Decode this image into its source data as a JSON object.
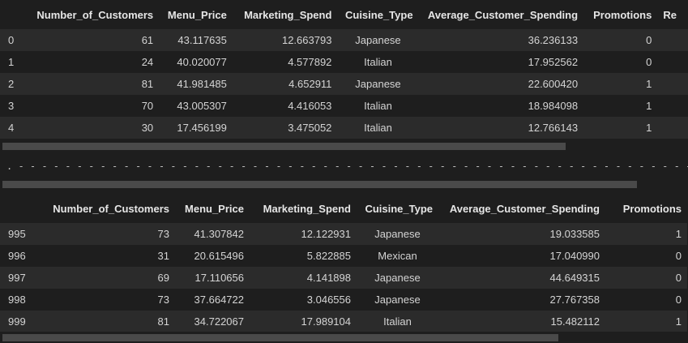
{
  "top_table": {
    "columns": [
      "",
      "Number_of_Customers",
      "Menu_Price",
      "Marketing_Spend",
      "Cuisine_Type",
      "Average_Customer_Spending",
      "Promotions",
      "Re"
    ],
    "rows": [
      [
        "0",
        "61",
        "43.117635",
        "12.663793",
        "Japanese",
        "36.236133",
        "0"
      ],
      [
        "1",
        "24",
        "40.020077",
        "4.577892",
        "Italian",
        "17.952562",
        "0"
      ],
      [
        "2",
        "81",
        "41.981485",
        "4.652911",
        "Japanese",
        "22.600420",
        "1"
      ],
      [
        "3",
        "70",
        "43.005307",
        "4.416053",
        "Italian",
        "18.984098",
        "1"
      ],
      [
        "4",
        "30",
        "17.456199",
        "3.475052",
        "Italian",
        "12.766143",
        "1"
      ]
    ]
  },
  "separator": {
    "text": ". - - - - - - - - - - - - - - - - - - - - - - - - - - - - - - - - - - - - - - - - - - - - - - - - - - - - - - - - - - - - - - - - - - - - - - - - - - - - - - - - - - - - - - - - - - - - - - - - - - - - - - - -"
  },
  "bottom_table": {
    "columns": [
      "",
      "Number_of_Customers",
      "Menu_Price",
      "Marketing_Spend",
      "Cuisine_Type",
      "Average_Customer_Spending",
      "Promotions"
    ],
    "rows": [
      [
        "995",
        "73",
        "41.307842",
        "12.122931",
        "Japanese",
        "19.033585",
        "1"
      ],
      [
        "996",
        "31",
        "20.615496",
        "5.822885",
        "Mexican",
        "17.040990",
        "0"
      ],
      [
        "997",
        "69",
        "17.110656",
        "4.141898",
        "Japanese",
        "44.649315",
        "0"
      ],
      [
        "998",
        "73",
        "37.664722",
        "3.046556",
        "Japanese",
        "27.767358",
        "0"
      ],
      [
        "999",
        "81",
        "34.722067",
        "17.989104",
        "Italian",
        "15.482112",
        "1"
      ]
    ]
  }
}
